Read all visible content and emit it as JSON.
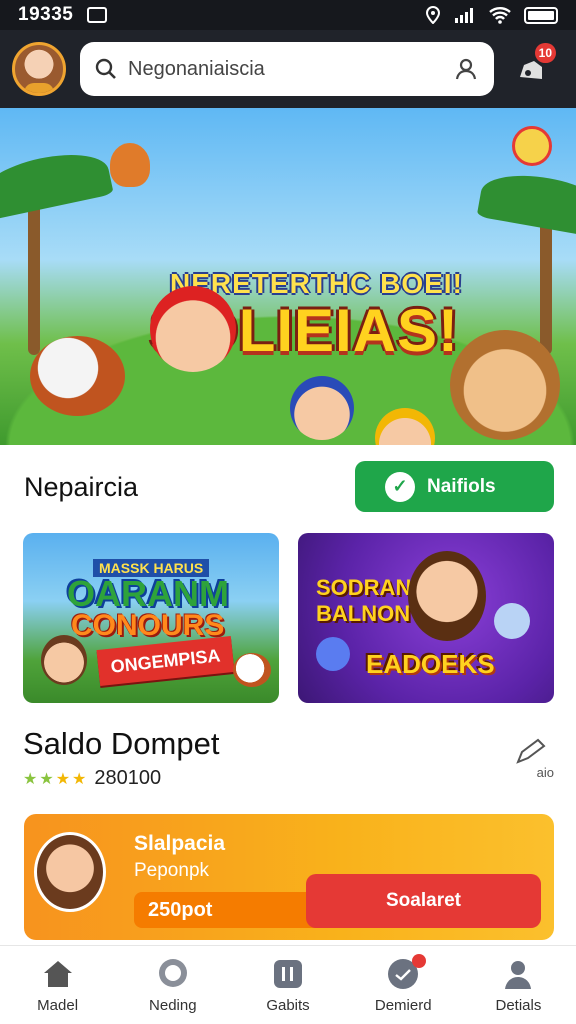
{
  "status_bar": {
    "time": "19335"
  },
  "header": {
    "search_text": "Negonaniaiscia",
    "notification_count": "10"
  },
  "hero": {
    "headline_small": "NERETERTHC BOEI!",
    "headline_big": "SOLIEIAS!",
    "slides": 4,
    "active_slide": 0
  },
  "section": {
    "title": "Nepaircia",
    "action_label": "Naifiols"
  },
  "promo_cards": [
    {
      "tag": "MASSK HARUS",
      "line1": "OARANM",
      "line2": "CONOURS",
      "ribbon": "ONGEMPISA"
    },
    {
      "line1": "SODRAN",
      "line2": "BALNON",
      "line3": "EADOEKS"
    }
  ],
  "wallet_header": {
    "title": "Saldo Dompet",
    "rating_value": "280100",
    "stars": 4,
    "edit_label": "aio"
  },
  "wallet_card": {
    "title": "Slalpacia",
    "subtitle": "Peponpk",
    "amount": "250pot",
    "button": "Soalaret"
  },
  "bottom_nav": [
    {
      "label": "Madel",
      "icon": "home-icon"
    },
    {
      "label": "Neding",
      "icon": "chat-icon"
    },
    {
      "label": "Gabits",
      "icon": "apps-icon"
    },
    {
      "label": "Demierd",
      "icon": "messages-icon",
      "badge": true
    },
    {
      "label": "Detials",
      "icon": "person-icon"
    }
  ],
  "colors": {
    "accent_green": "#1fa64a",
    "accent_red": "#e53935",
    "wallet_orange": "#f7931e",
    "topbar": "#20232a"
  }
}
